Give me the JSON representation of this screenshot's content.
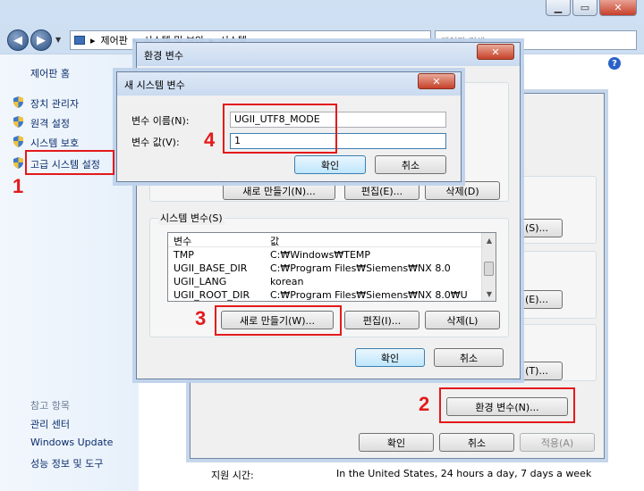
{
  "explorer": {
    "breadcrumb": [
      "제어판",
      "시스템 및 보안",
      "시스템"
    ],
    "search_placeholder": "제어판 검색",
    "sidebar": {
      "home": "제어판 홈",
      "items": [
        "장치 관리자",
        "원격 설정",
        "시스템 보호",
        "고급 시스템 설정"
      ],
      "see_also_header": "참고 항목",
      "see_also": [
        "관리 센터",
        "Windows Update",
        "성능 정보 및 도구"
      ]
    },
    "support_label": "지원 시간:",
    "support_value": "In the United States, 24 hours a day, 7 days a week"
  },
  "system_properties": {
    "buttons": {
      "env_vars": "환경 변수(N)...",
      "ok": "확인",
      "cancel": "취소",
      "apply": "적용(A)",
      "settings_s": "(S)...",
      "settings_e": "(E)...",
      "settings_t": "(T)..."
    }
  },
  "env_dialog": {
    "title": "환경 변수",
    "user_buttons": {
      "new": "새로 만들기(N)...",
      "edit": "편집(E)...",
      "delete": "삭제(D)"
    },
    "system_group": "시스템 변수(S)",
    "columns": {
      "name": "변수",
      "value": "값"
    },
    "rows": [
      {
        "name": "TMP",
        "value": "C:₩Windows₩TEMP"
      },
      {
        "name": "UGII_BASE_DIR",
        "value": "C:₩Program Files₩Siemens₩NX 8.0"
      },
      {
        "name": "UGII_LANG",
        "value": "korean"
      },
      {
        "name": "UGII_ROOT_DIR",
        "value": "C:₩Program Files₩Siemens₩NX 8.0₩U"
      }
    ],
    "system_buttons": {
      "new": "새로 만들기(W)...",
      "edit": "편집(I)...",
      "delete": "삭제(L)"
    },
    "ok": "확인",
    "cancel": "취소"
  },
  "new_var_dialog": {
    "title": "새 시스템 변수",
    "name_label": "변수 이름(N):",
    "value_label": "변수 값(V):",
    "name_value": "UGII_UTF8_MODE",
    "value_value": "1",
    "ok": "확인",
    "cancel": "취소"
  },
  "annotations": [
    "1",
    "2",
    "3",
    "4"
  ],
  "colors": {
    "annotation": "#e4191b",
    "link": "#0b2d6b",
    "default_button": "#bee6fd"
  }
}
